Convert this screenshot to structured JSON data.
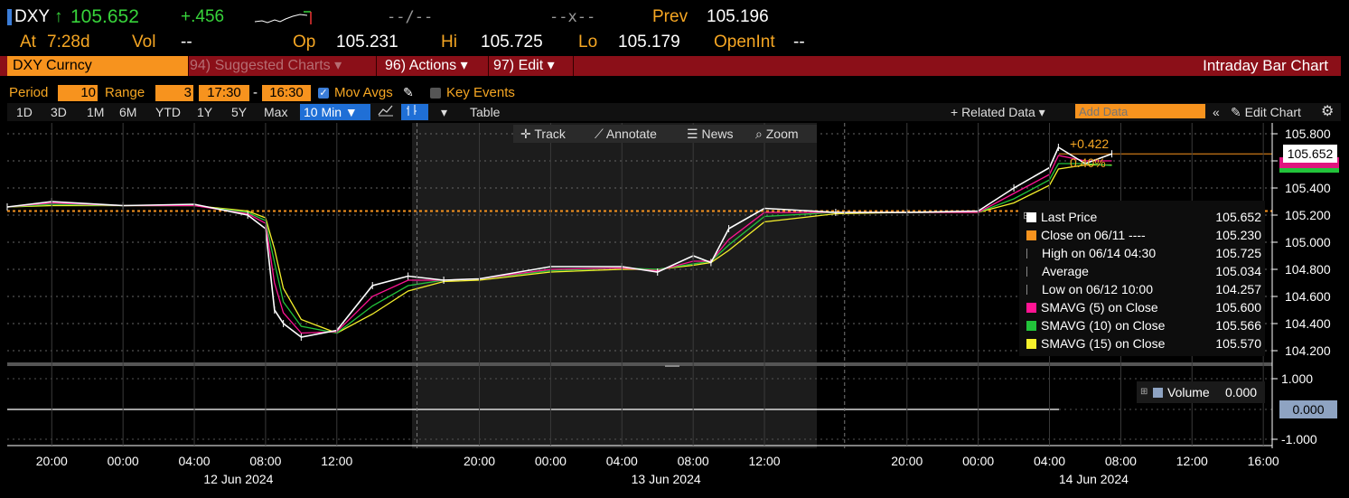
{
  "header": {
    "ticker": "DXY",
    "arrow": "↑",
    "last": "105.652",
    "change": "+.456",
    "bid_ask": "--/--",
    "size": "--x--",
    "prev_label": "Prev",
    "prev": "105.196",
    "at_label": "At",
    "at_time": "7:28d",
    "vol_label": "Vol",
    "vol": "--",
    "op_label": "Op",
    "op": "105.231",
    "hi_label": "Hi",
    "hi": "105.725",
    "lo_label": "Lo",
    "lo": "105.179",
    "openint_label": "OpenInt",
    "openint": "--"
  },
  "toolbar": {
    "security": "DXY Curncy",
    "suggested": "94) Suggested Charts",
    "actions": "96) Actions",
    "edit": "97) Edit",
    "title": "Intraday Bar Chart"
  },
  "settings": {
    "period_label": "Period",
    "period": "10",
    "range_label": "Range",
    "range": "3",
    "start": "17:30",
    "dash": "-",
    "end": "16:30",
    "mov_avgs": "Mov Avgs",
    "key_events": "Key Events"
  },
  "ranges": [
    "1D",
    "3D",
    "1M",
    "6M",
    "YTD",
    "1Y",
    "5Y",
    "Max"
  ],
  "interval": "10 Min ▼",
  "table_label": "Table",
  "related_data": "+ Related Data ▾",
  "add_data_placeholder": "Add Data",
  "edit_chart": "Edit Chart",
  "chart_tools": {
    "track": "Track",
    "annotate": "Annotate",
    "news": "News",
    "zoom": "Zoom"
  },
  "price_axis": [
    "105.800",
    "105.600",
    "105.400",
    "105.200",
    "105.000",
    "104.800",
    "104.600",
    "104.400",
    "104.200"
  ],
  "volume_axis": [
    "1.000",
    "0.000",
    "-1.000"
  ],
  "last_tag": "105.652",
  "change_tag": "+0.422",
  "pct_tag": "0.40%",
  "legend": [
    {
      "label": "Last Price",
      "value": "105.652",
      "color": "#ffffff"
    },
    {
      "label": "Close on 06/11 ----",
      "value": "105.230",
      "color": "#f7931e"
    },
    {
      "label": "High on 06/14 04:30",
      "value": "105.725",
      "color": "#888888"
    },
    {
      "label": "Average",
      "value": "105.034",
      "color": "#888888"
    },
    {
      "label": "Low on 06/12 10:00",
      "value": "104.257",
      "color": "#888888"
    },
    {
      "label": "SMAVG (5)  on Close",
      "value": "105.600",
      "color": "#ff1493"
    },
    {
      "label": "SMAVG (10)  on Close",
      "value": "105.566",
      "color": "#22c33a"
    },
    {
      "label": "SMAVG (15)  on Close",
      "value": "105.570",
      "color": "#f5f02c"
    }
  ],
  "volume_legend": {
    "label": "Volume",
    "value": "0.000"
  },
  "time_labels": [
    "20:00",
    "00:00",
    "04:00",
    "08:00",
    "12:00",
    "20:00",
    "00:00",
    "04:00",
    "08:00",
    "12:00",
    "20:00",
    "00:00",
    "04:00",
    "08:00",
    "12:00",
    "16:00"
  ],
  "date_labels": [
    "12 Jun 2024",
    "13 Jun 2024",
    "14 Jun 2024"
  ],
  "chart_data": {
    "type": "line",
    "title": "Intraday Bar Chart",
    "ylim": [
      104.2,
      105.8
    ],
    "x": [
      "06/11 17:30",
      "06/11 20:00",
      "06/12 00:00",
      "06/12 04:00",
      "06/12 07:00",
      "06/12 08:00",
      "06/12 08:30",
      "06/12 09:00",
      "06/12 10:00",
      "06/12 12:00",
      "06/12 14:00",
      "06/12 16:00",
      "06/12 18:00",
      "06/12 20:00",
      "06/13 00:00",
      "06/13 04:00",
      "06/13 06:00",
      "06/13 08:00",
      "06/13 09:00",
      "06/13 10:00",
      "06/13 12:00",
      "06/13 16:00",
      "06/13 20:00",
      "06/14 00:00",
      "06/14 02:00",
      "06/14 04:00",
      "06/14 04:30",
      "06/14 06:00",
      "06/14 07:30"
    ],
    "series": [
      {
        "name": "Last Price",
        "values": [
          105.26,
          105.3,
          105.27,
          105.28,
          105.2,
          105.1,
          104.5,
          104.4,
          104.3,
          104.35,
          104.68,
          104.75,
          104.72,
          104.73,
          104.82,
          104.82,
          104.78,
          104.9,
          104.85,
          105.1,
          105.25,
          105.22,
          105.22,
          105.23,
          105.4,
          105.55,
          105.7,
          105.58,
          105.652
        ]
      },
      {
        "name": "SMAVG (5)",
        "values": [
          105.26,
          105.29,
          105.27,
          105.27,
          105.21,
          105.14,
          104.7,
          104.48,
          104.33,
          104.34,
          104.6,
          104.72,
          104.72,
          104.73,
          104.8,
          104.81,
          104.79,
          104.86,
          104.86,
          105.02,
          105.22,
          105.22,
          105.22,
          105.22,
          105.36,
          105.5,
          105.64,
          105.6,
          105.6
        ]
      },
      {
        "name": "SMAVG (10)",
        "values": [
          105.26,
          105.28,
          105.27,
          105.27,
          105.22,
          105.16,
          104.85,
          104.56,
          104.38,
          104.33,
          104.53,
          104.68,
          104.72,
          104.73,
          104.79,
          104.81,
          104.8,
          104.84,
          104.86,
          104.98,
          105.19,
          105.22,
          105.22,
          105.22,
          105.32,
          105.46,
          105.58,
          105.58,
          105.566
        ]
      },
      {
        "name": "SMAVG (15)",
        "values": [
          105.26,
          105.27,
          105.27,
          105.27,
          105.23,
          105.18,
          104.95,
          104.66,
          104.43,
          104.33,
          104.47,
          104.64,
          104.71,
          104.72,
          104.78,
          104.8,
          104.8,
          104.83,
          104.85,
          104.94,
          105.15,
          105.21,
          105.22,
          105.22,
          105.29,
          105.42,
          105.54,
          105.57,
          105.57
        ]
      }
    ],
    "reference_line": {
      "name": "Close on 06/11",
      "value": 105.23
    }
  }
}
